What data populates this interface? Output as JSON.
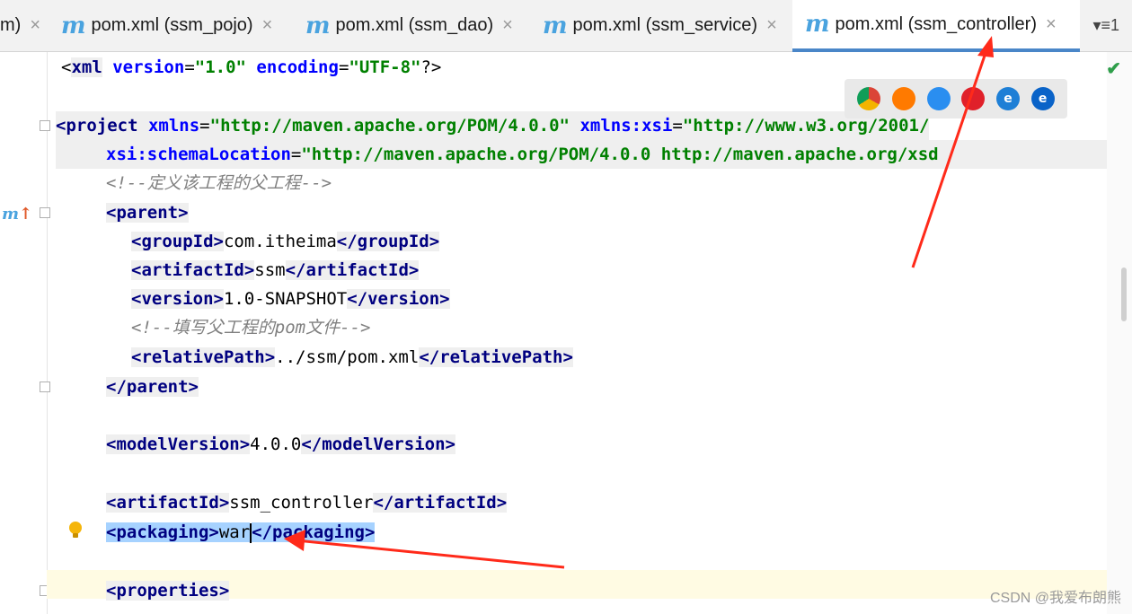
{
  "tabs": [
    {
      "label": "m)",
      "close": "×",
      "has_icon": false
    },
    {
      "label": "pom.xml (ssm_pojo)",
      "close": "×",
      "icon": "m"
    },
    {
      "label": "pom.xml (ssm_dao)",
      "close": "×",
      "icon": "m"
    },
    {
      "label": "pom.xml (ssm_service)",
      "close": "×",
      "icon": "m"
    },
    {
      "label": "pom.xml (ssm_controller)",
      "close": "×",
      "icon": "m",
      "active": true
    }
  ],
  "tab_menu": "▾≡1",
  "code": {
    "l1_a": "version",
    "l1_v1": "\"1.0\"",
    "l1_b": "encoding",
    "l1_v2": "\"UTF-8\"",
    "l1_pre": "<",
    "l1_tag": "xml",
    "l1_end": "?>",
    "l3_tag": "<project",
    "l3_a1": "xmlns",
    "l3_v1": "\"http://maven.apache.org/POM/4.0.0\"",
    "l3_a2": "xmlns:xsi",
    "l3_v2": "\"http://www.w3.org/2001/",
    "l4_a": "xsi:schemaLocation",
    "l4_v": "\"http://maven.apache.org/POM/4.0.0 http://maven.apache.org/xsd",
    "l5": "<!--定义该工程的父工程-->",
    "l6_open": "<parent>",
    "l7_open": "<groupId>",
    "l7_text": "com.itheima",
    "l7_close": "</groupId>",
    "l8_open": "<artifactId>",
    "l8_text": "ssm",
    "l8_close": "</artifactId>",
    "l9_open": "<version>",
    "l9_text": "1.0-SNAPSHOT",
    "l9_close": "</version>",
    "l10": "<!--填写父工程的pom文件-->",
    "l11_open": "<relativePath>",
    "l11_text": "../ssm/pom.xml",
    "l11_close": "</relativePath>",
    "l12_close": "</parent>",
    "l14_open": "<modelVersion>",
    "l14_text": "4.0.0",
    "l14_close": "</modelVersion>",
    "l16_open": "<artifactId>",
    "l16_text": "ssm_controller",
    "l16_close": "</artifactId>",
    "l17_open": "<packaging>",
    "l17_text_a": "war",
    "l17_close": "</packaging>",
    "l19_open": "<properties>"
  },
  "watermark": "CSDN @我爱布朗熊",
  "gutter_marker": "m",
  "colors": {
    "tag": "#000080",
    "attr": "#0000ff",
    "value": "#008000",
    "comment": "#808080",
    "arrow": "#ff2a1a"
  }
}
